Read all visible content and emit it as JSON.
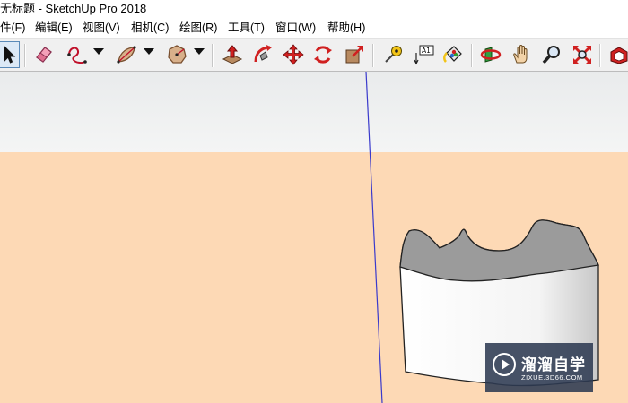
{
  "window": {
    "title": "无标题 - SketchUp Pro 2018"
  },
  "menu": {
    "items": [
      {
        "label": "件(F)"
      },
      {
        "label": "编辑(E)"
      },
      {
        "label": "视图(V)"
      },
      {
        "label": "相机(C)"
      },
      {
        "label": "绘图(R)"
      },
      {
        "label": "工具(T)"
      },
      {
        "label": "窗口(W)"
      },
      {
        "label": "帮助(H)"
      }
    ]
  },
  "toolbar": {
    "text_tool_glyph": "A1",
    "tools": [
      "select-icon",
      "eraser-icon",
      "freehand-icon",
      "arc-icon",
      "polygon-icon",
      "push-pull-icon",
      "follow-me-icon",
      "move-icon",
      "rotate-icon",
      "scale-icon",
      "tape-measure-icon",
      "text-icon",
      "paint-bucket-icon",
      "orbit-icon",
      "pan-icon",
      "zoom-icon",
      "zoom-extents-icon",
      "warehouse-icon"
    ]
  },
  "viewport": {
    "sky_color": "#eceeee",
    "ground_color": "#fdd9b5",
    "axis_color": "#3a3acc",
    "model_top_color": "#9b9b9b",
    "model_side_color": "#f4f4f4"
  },
  "watermark": {
    "brand": "溜溜自学",
    "url": "ZIXUE.3D66.COM"
  }
}
